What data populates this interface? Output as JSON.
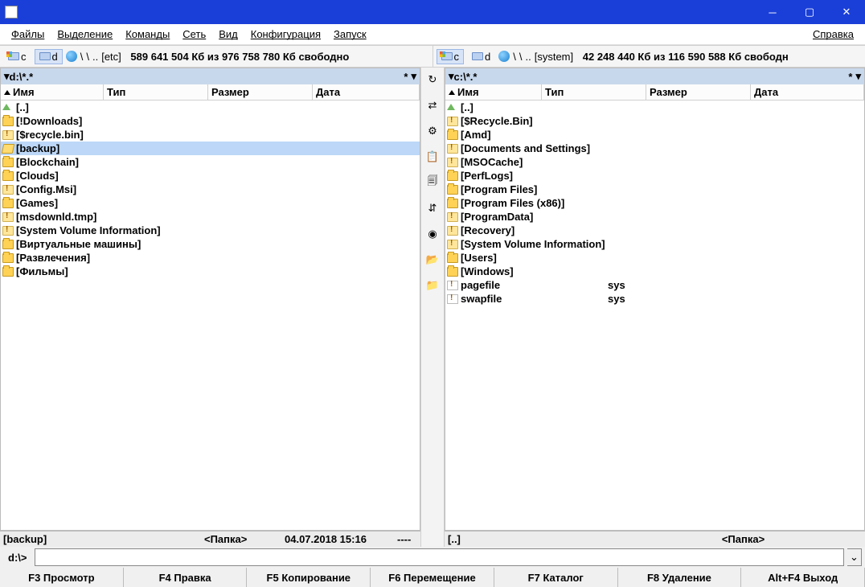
{
  "titlebar": {
    "title": ""
  },
  "menu": {
    "files": "Файлы",
    "selection": "Выделение",
    "commands": "Команды",
    "net": "Сеть",
    "view": "Вид",
    "config": "Конфигурация",
    "start": "Запуск",
    "help": "Справка"
  },
  "drivebar": {
    "left": {
      "c": "c",
      "d": "d",
      "label": "[etc]",
      "free": "589 641 504 Кб из 976 758 780 Кб свободно",
      "backslash": "\\",
      "dots": ".."
    },
    "right": {
      "c": "c",
      "d": "d",
      "label": "[system]",
      "free": "42 248 440 Кб из 116 590 588 Кб свободн",
      "backslash": "\\",
      "dots": ".."
    }
  },
  "left": {
    "path": "d:\\*.*",
    "cols": {
      "name": "Имя",
      "type": "Тип",
      "size": "Размер",
      "date": "Дата"
    },
    "items": [
      {
        "icon": "up",
        "name": "[..]"
      },
      {
        "icon": "folder",
        "name": "[!Downloads]"
      },
      {
        "icon": "folder-excl",
        "name": "[$recycle.bin]"
      },
      {
        "icon": "folder-open",
        "name": "[backup]",
        "selected": true
      },
      {
        "icon": "folder",
        "name": "[Blockchain]"
      },
      {
        "icon": "folder",
        "name": "[Clouds]"
      },
      {
        "icon": "folder-excl",
        "name": "[Config.Msi]"
      },
      {
        "icon": "folder",
        "name": "[Games]"
      },
      {
        "icon": "folder-excl",
        "name": "[msdownld.tmp]"
      },
      {
        "icon": "folder-excl",
        "name": "[System Volume Information]"
      },
      {
        "icon": "folder",
        "name": "[Виртуальные машины]"
      },
      {
        "icon": "folder",
        "name": "[Развлечения]"
      },
      {
        "icon": "folder",
        "name": "[Фильмы]"
      }
    ],
    "status": {
      "name": "[backup]",
      "type": "<Папка>",
      "date": "04.07.2018 15:16",
      "attr": "----"
    }
  },
  "right": {
    "path": "c:\\*.*",
    "cols": {
      "name": "Имя",
      "type": "Тип",
      "size": "Размер",
      "date": "Дата"
    },
    "items": [
      {
        "icon": "up",
        "name": "[..]"
      },
      {
        "icon": "folder-excl",
        "name": "[$Recycle.Bin]"
      },
      {
        "icon": "folder",
        "name": "[Amd]"
      },
      {
        "icon": "folder-excl",
        "name": "[Documents and Settings]"
      },
      {
        "icon": "folder-excl",
        "name": "[MSOCache]"
      },
      {
        "icon": "folder",
        "name": "[PerfLogs]"
      },
      {
        "icon": "folder",
        "name": "[Program Files]"
      },
      {
        "icon": "folder",
        "name": "[Program Files (x86)]"
      },
      {
        "icon": "folder-excl",
        "name": "[ProgramData]"
      },
      {
        "icon": "folder-excl",
        "name": "[Recovery]"
      },
      {
        "icon": "folder-excl",
        "name": "[System Volume Information]"
      },
      {
        "icon": "folder",
        "name": "[Users]"
      },
      {
        "icon": "folder",
        "name": "[Windows]"
      },
      {
        "icon": "file-excl",
        "name": "pagefile",
        "type": "sys"
      },
      {
        "icon": "file-excl",
        "name": "swapfile",
        "type": "sys"
      }
    ],
    "status": {
      "name": "[..]",
      "type": "<Папка>"
    }
  },
  "cmdline": {
    "prompt": "d:\\>"
  },
  "fkeys": {
    "f3": "F3 Просмотр",
    "f4": "F4 Правка",
    "f5": "F5 Копирование",
    "f6": "F6 Перемещение",
    "f7": "F7 Каталог",
    "f8": "F8 Удаление",
    "altf4": "Alt+F4 Выход"
  },
  "mid_icons": [
    "↻",
    "⇄",
    "⚙",
    "📋",
    "🗐",
    "⇵",
    "◉",
    "📂",
    "📁"
  ]
}
